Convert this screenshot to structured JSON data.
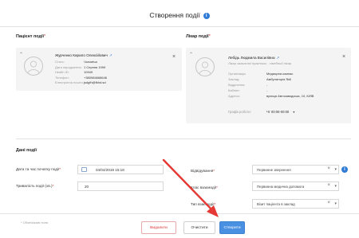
{
  "header": {
    "title": "Створення події"
  },
  "patient": {
    "section_label": "Пацієнт події",
    "required": "*",
    "name": "Журченко Кирило Олексійович",
    "edit_icon": "↗",
    "fields": [
      {
        "label": "Стать:",
        "value": "Чоловіча"
      },
      {
        "label": "Дата народження:",
        "value": "1 Серпня 1999"
      },
      {
        "label": "Health ID:",
        "value": "10949"
      },
      {
        "label": "Телефон:",
        "value": "+380984668646"
      },
      {
        "label": "Електронна пошта:",
        "value": "jsdgfh@fkhd.sd"
      }
    ],
    "close_icon": "×"
  },
  "doctor": {
    "section_label": "Лікар події",
    "required": "*",
    "name": "Лебідь Людмила Василівна",
    "edit_icon": "↗",
    "specialty": "Лікар загальної практики - сімейний лікар",
    "fields": [
      {
        "label": "Організація:",
        "value": "Медицина комнас"
      },
      {
        "label": "Заклад:",
        "value": "Амбулаторія №6"
      },
      {
        "label": "Відділення:",
        "value": "-"
      },
      {
        "label": "Кабінет:",
        "value": "-"
      },
      {
        "label": "Адреса:",
        "value": "вулиця Автозаводська, 10, КИЇВ"
      }
    ],
    "schedule_label": "Графік роботи:",
    "schedule_value": "Чт 00:00-00:00",
    "schedule_chevron": "▾",
    "close_icon": "×"
  },
  "event_data": {
    "section_label": "Дані події",
    "datetime_label": "Дата та час початку події",
    "datetime_value": "04/04/2019 15:18",
    "duration_label": "Тривалість події (хв.)",
    "duration_value": "20",
    "visit_label": "Відвідування",
    "visit_value": "Первинне звернення",
    "assist_label": "Клас взаємодії",
    "assist_value": "Первинна медична допомога",
    "type_label": "Тип взаємодії",
    "type_value": "Візит пацієнта в заклад",
    "required": "*",
    "clear_icon": "×",
    "dropdown_icon": "▾",
    "info_icon": "i"
  },
  "footer": {
    "required_note": "* Обов'язкові поля",
    "delete_label": "Видалити",
    "clear_label": "Очистити",
    "create_label": "Створити"
  },
  "colors": {
    "accent": "#4a90e2",
    "danger": "#d33333",
    "arrow": "#e53935"
  }
}
